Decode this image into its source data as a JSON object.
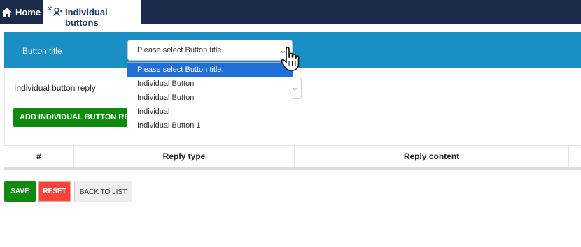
{
  "nav": {
    "home_label": "Home",
    "active_tab_label": "Individual buttons"
  },
  "form": {
    "button_title_label": "Button title",
    "button_title_select_value": "Please select Button title.",
    "reply_label": "Individual button reply",
    "add_reply_button": "ADD INDIVIDUAL BUTTON REPLY"
  },
  "dropdown": {
    "options": [
      "Please select Button title.",
      "Individual Button",
      "Individual Button",
      "Individual",
      "Individual Button 1"
    ],
    "selected_index": 0
  },
  "table": {
    "headers": [
      "#",
      "Reply type",
      "Reply content"
    ]
  },
  "footer": {
    "save_label": "SAVE",
    "reset_label": "RESET",
    "back_label": "BACK TO LIST"
  },
  "colors": {
    "topbar": "#1c2b4a",
    "panel_header": "#1a8fc3",
    "save": "#0e8a0e",
    "reset": "#f5443a",
    "dropdown_selected": "#1f6fd6"
  }
}
